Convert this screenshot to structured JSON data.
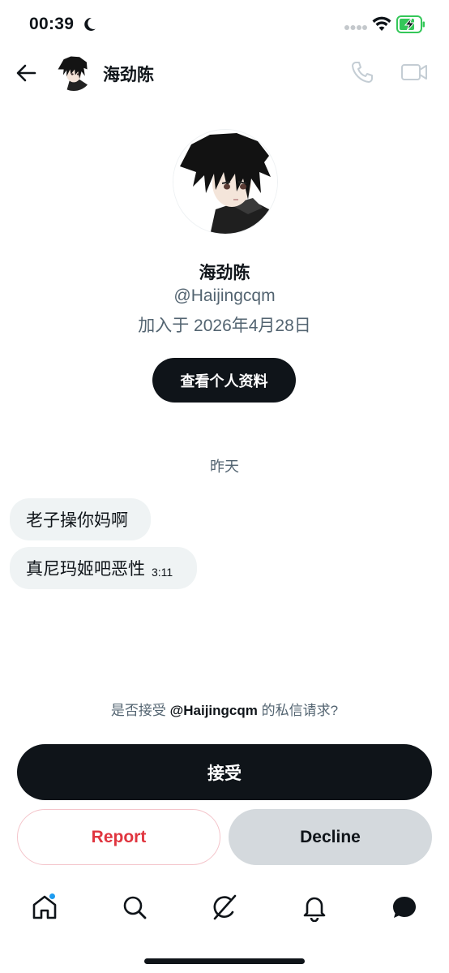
{
  "status_bar": {
    "time": "00:39"
  },
  "header": {
    "name": "海劲陈"
  },
  "profile": {
    "name": "海劲陈",
    "handle": "@Haijingcqm",
    "joined": "加入于 2026年4月28日",
    "view_profile_label": "查看个人资料"
  },
  "conversation": {
    "date_separator": "昨天",
    "messages": [
      {
        "text": "老子操你妈啊",
        "time": ""
      },
      {
        "text": "真尼玛姬吧恶性",
        "time": "3:11"
      }
    ]
  },
  "request": {
    "prompt_prefix": "是否接受",
    "prompt_handle": "@Haijingcqm",
    "prompt_suffix": "的私信请求?",
    "accept_label": "接受",
    "report_label": "Report",
    "decline_label": "Decline"
  },
  "tab_bar": {
    "tabs": [
      "home-icon",
      "search-icon",
      "grok-icon",
      "notifications-icon",
      "messages-icon"
    ],
    "has_home_notification": true
  },
  "colors": {
    "primary": "#0f1419",
    "secondary_text": "#536471",
    "report_red": "#e0353f",
    "bubble": "#eff3f4",
    "decline_bg": "#d4d9dd",
    "accent_blue": "#1d9bf0",
    "battery_green": "#34c759"
  }
}
